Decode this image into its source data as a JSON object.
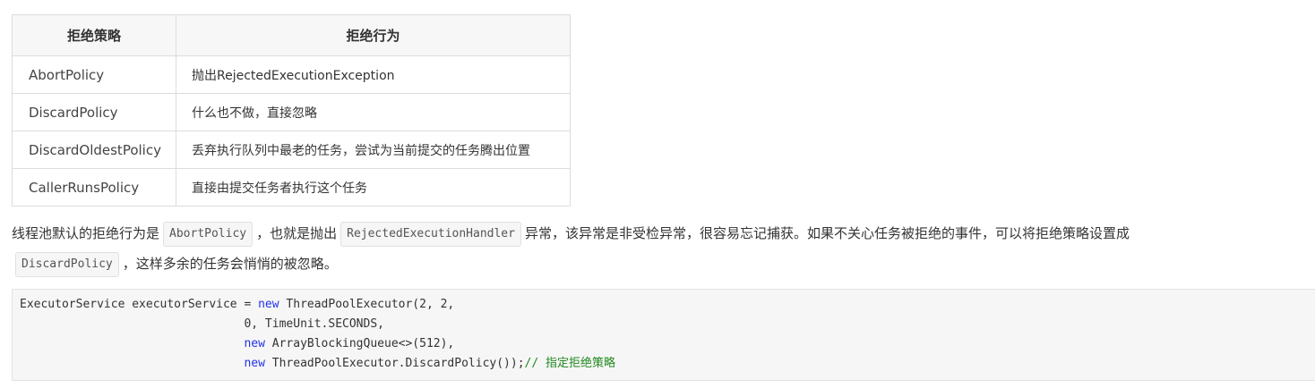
{
  "table": {
    "headers": [
      "拒绝策略",
      "拒绝行为"
    ],
    "rows": [
      {
        "policy": "AbortPolicy",
        "behavior": "抛出RejectedExecutionException"
      },
      {
        "policy": "DiscardPolicy",
        "behavior": "什么也不做，直接忽略"
      },
      {
        "policy": "DiscardOldestPolicy",
        "behavior": "丢弃执行队列中最老的任务，尝试为当前提交的任务腾出位置"
      },
      {
        "policy": "CallerRunsPolicy",
        "behavior": "直接由提交任务者执行这个任务"
      }
    ]
  },
  "paragraph": {
    "part1": "线程池默认的拒绝行为是",
    "code1": "AbortPolicy",
    "part2": "，也就是抛出",
    "code2": "RejectedExecutionHandler",
    "part3": "异常，该异常是非受检异常，很容易忘记捕获。如果不关心任务被拒绝的事件，可以将拒绝策略设置成",
    "code3": "DiscardPolicy",
    "part4": "，这样多余的任务会悄悄的被忽略。"
  },
  "code": {
    "l1_a": "ExecutorService executorService = ",
    "l1_kw": "new",
    "l1_b": " ThreadPoolExecutor(2, 2,",
    "l2": "                                0, TimeUnit.SECONDS,",
    "l3_indent": "                                ",
    "l3_kw": "new",
    "l3_b": " ArrayBlockingQueue<>(512),",
    "l4_indent": "                                ",
    "l4_kw": "new",
    "l4_b": " ThreadPoolExecutor.DiscardPolicy());",
    "l4_comment": "// 指定拒绝策略"
  }
}
